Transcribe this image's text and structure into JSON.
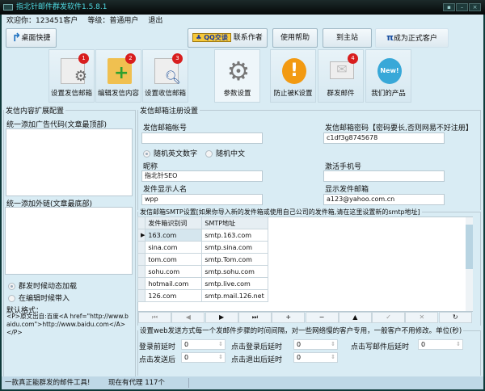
{
  "window": {
    "title": "指北针邮件群发软件1.5.8.1"
  },
  "info": {
    "welcome": "欢迎你：123451客户",
    "level": "等级：普通用户",
    "logout": "退出"
  },
  "toolbar": {
    "desktop_shortcut": "桌面快捷",
    "qq_chat": "QQ交谈",
    "contact_author": "联系作者",
    "help": "使用帮助",
    "home_site": "到主站",
    "become_customer": "成为正式客户"
  },
  "tabs": [
    {
      "label": "设置发信邮箱",
      "badge": "1"
    },
    {
      "label": "编辑发信内容",
      "badge": "2"
    },
    {
      "label": "设置收信邮箱",
      "badge": "3"
    },
    {
      "label": "参数设置"
    },
    {
      "label": "防止被K设置"
    },
    {
      "label": "群发邮件",
      "badge": "4"
    },
    {
      "label": "我们的产品",
      "badge_text": "New!"
    }
  ],
  "left": {
    "legend": "发信内容扩展配置",
    "top_label": "统一添加广告代码(文章最顶部)",
    "bottom_label": "统一添加外链(文章最底部)",
    "radio1": "群发时候动态加载",
    "radio2": "在编辑时候带入",
    "default_label": "默认格式：",
    "default_text": "<P>原文出自:百度<A href=\"http://www.baidu.com\">http://www.baidu.com</A></P>"
  },
  "register": {
    "legend": "发信邮箱注册设置",
    "account_label": "发信邮箱帐号",
    "account_value": "",
    "password_label": "发信邮箱密码【密码要长,否则网易不好注册】",
    "password_value": "c1df3g8745678",
    "random_en": "随机英文数字",
    "random_cn": "随机中文",
    "nickname_label": "昵称",
    "nickname_value": "指北针SEO",
    "phone_label": "激活手机号",
    "phone_value": "",
    "display_name_label": "发件显示人名",
    "display_name_value": "wpp",
    "display_email_label": "显示发件邮箱",
    "display_email_value": "a123@yahoo.com.cn"
  },
  "smtp": {
    "legend": "发信邮箱SMTP设置[如果你导入新的发件箱或使用自己公司的发件箱,请在这里设置新的smtp地址]",
    "columns": [
      "发件箱识别词",
      "SMTP地址"
    ],
    "rows": [
      [
        "163.com",
        "smtp.163.com"
      ],
      [
        "sina.com",
        "smtp.sina.com"
      ],
      [
        "tom.com",
        "smtp.Tom.com"
      ],
      [
        "sohu.com",
        "smtp.sohu.com"
      ],
      [
        "hotmail.com",
        "smtp.live.com"
      ],
      [
        "126.com",
        "smtp.mail.126.net"
      ]
    ],
    "nav": [
      "⏮",
      "◀",
      "▶",
      "⏭",
      "+",
      "−",
      "▲",
      "✓",
      "✕",
      "↻"
    ]
  },
  "delay": {
    "legend": "设置web发送方式每一个发邮件步骤的时间间隔，对一些网络慢的客户专用，一般客户不用修改。单位(秒)",
    "before_login": "登录前延时",
    "before_login_v": "0",
    "after_login": "点击登录后延时",
    "after_login_v": "0",
    "after_write": "点击写邮件后延时",
    "after_write_v": "0",
    "after_send": "点击发送后",
    "after_send_v": "0",
    "after_logout": "点击退出后延时",
    "after_logout_v": "0"
  },
  "status": {
    "slogan": "一款真正能群发的邮件工具!",
    "proxy": "现在有代理 117个"
  }
}
